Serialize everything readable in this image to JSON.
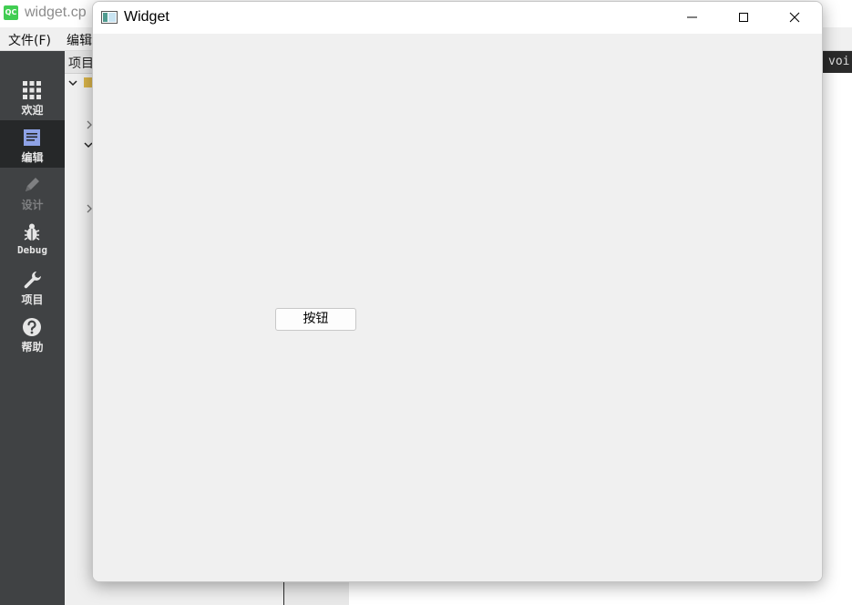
{
  "background_app": {
    "title": "widget.cp",
    "logo_text": "QC",
    "menu": [
      "文件(F)",
      "编辑"
    ],
    "modes": [
      {
        "label": "欢迎",
        "icon": "grid-icon",
        "active": false,
        "disabled": false
      },
      {
        "label": "编辑",
        "icon": "document-icon",
        "active": true,
        "disabled": false
      },
      {
        "label": "设计",
        "icon": "pencil-icon",
        "active": false,
        "disabled": true
      },
      {
        "label": "Debug",
        "icon": "bug-icon",
        "active": false,
        "disabled": false
      },
      {
        "label": "项目",
        "icon": "wrench-icon",
        "active": false,
        "disabled": false
      },
      {
        "label": "帮助",
        "icon": "help-icon",
        "active": false,
        "disabled": false
      }
    ],
    "project_panel": {
      "header": "项目"
    },
    "editor": {
      "code_fragment": "voi"
    }
  },
  "widget_window": {
    "title": "Widget",
    "icon": "window-icon",
    "controls": {
      "minimize": "minimize-icon",
      "maximize": "maximize-icon",
      "close": "close-icon"
    },
    "button_label": "按钮"
  },
  "colors": {
    "qt_green": "#41cd52",
    "sidebar": "#404244",
    "sidebar_active": "#262829",
    "window_client": "#f0f0f0"
  }
}
